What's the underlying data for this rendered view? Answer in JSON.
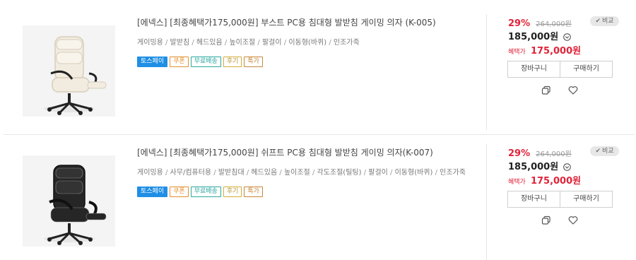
{
  "products": [
    {
      "title": "[에넥스] [최종혜택가175,000원] 부스트 PC용 침대형 발받침 게이밍 의자 (K-005)",
      "tags": [
        "게이밍용",
        "발받침",
        "헤드있음",
        "높이조절",
        "팔걸이",
        "이동형(바퀴)",
        "인조가죽"
      ],
      "badges": [
        "토스페이",
        "쿠폰",
        "무료배송",
        "후기",
        "특가"
      ],
      "discount": "29%",
      "original_price": "264,000원",
      "sale_price": "185,000원",
      "benefit_label": "혜택가",
      "benefit_price": "175,000원",
      "compare_label": "비교",
      "cart_label": "장바구니",
      "buy_label": "구매하기",
      "chair_color": "#f2ece0"
    },
    {
      "title": "[에넥스] [최종혜택가175,000원] 쉬프트 PC용 침대형 발받침 게이밍 의자(K-007)",
      "tags": [
        "게이밍용",
        "사무/컴퓨터용",
        "발받침대",
        "헤드있음",
        "높이조절",
        "각도조절(틸팅)",
        "팔걸이",
        "이동형(바퀴)",
        "인조가죽"
      ],
      "badges": [
        "토스페이",
        "쿠폰",
        "무료배송",
        "후기",
        "특가"
      ],
      "discount": "29%",
      "original_price": "264,000원",
      "sale_price": "185,000원",
      "benefit_label": "혜택가",
      "benefit_price": "175,000원",
      "compare_label": "비교",
      "cart_label": "장바구니",
      "buy_label": "구매하기",
      "chair_color": "#262626"
    }
  ]
}
